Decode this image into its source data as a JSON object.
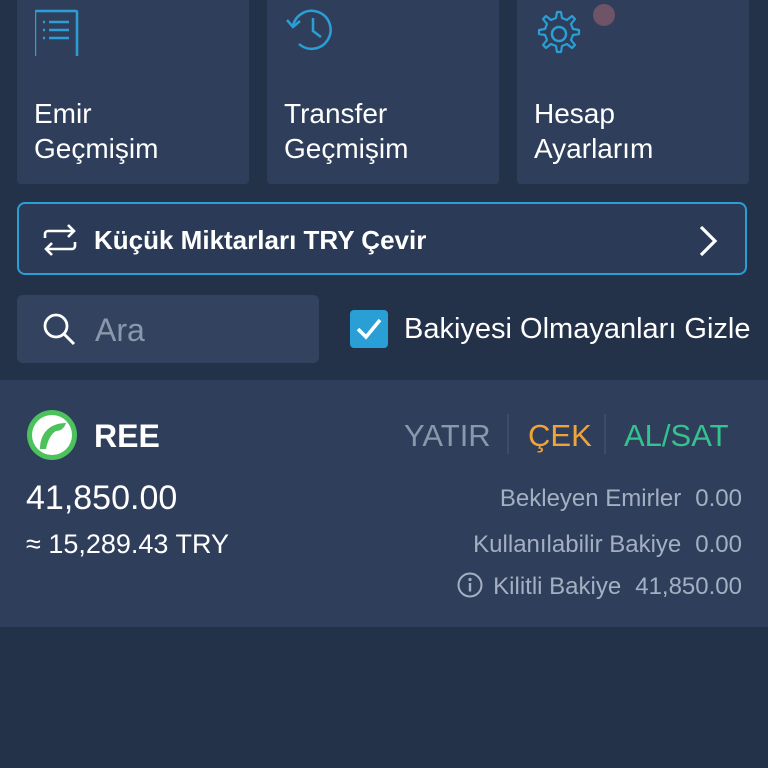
{
  "tiles": [
    {
      "label": "Emir\nGeçmişim",
      "icon": "document-list-icon"
    },
    {
      "label": "Transfer\nGeçmişim",
      "icon": "history-icon"
    },
    {
      "label": "Hesap\nAyarlarım",
      "icon": "gear-icon"
    }
  ],
  "convert": {
    "label": "Küçük Miktarları TRY Çevir",
    "icon": "swap-arrows-icon"
  },
  "search": {
    "placeholder": "Ara",
    "value": ""
  },
  "filter": {
    "label": "Bakiyesi Olmayanları Gizle",
    "checked": true
  },
  "asset": {
    "symbol": "REE",
    "actions": {
      "deposit": "YATIR",
      "withdraw": "ÇEK",
      "trade": "AL/SAT"
    },
    "balance": "41,850.00",
    "try_value": "≈ 15,289.43 TRY",
    "details": [
      {
        "label": "Bekleyen Emirler",
        "value": "0.00"
      },
      {
        "label": "Kullanılabilir Bakiye",
        "value": "0.00"
      },
      {
        "label": "Kilitli Bakiye",
        "value": "41,850.00"
      }
    ]
  },
  "colors": {
    "background": "#243249",
    "card": "#2f3f5b",
    "accent": "#2a9fd6",
    "withdraw": "#f0a33a",
    "trade": "#34c38f",
    "muted": "#8b97ab"
  }
}
